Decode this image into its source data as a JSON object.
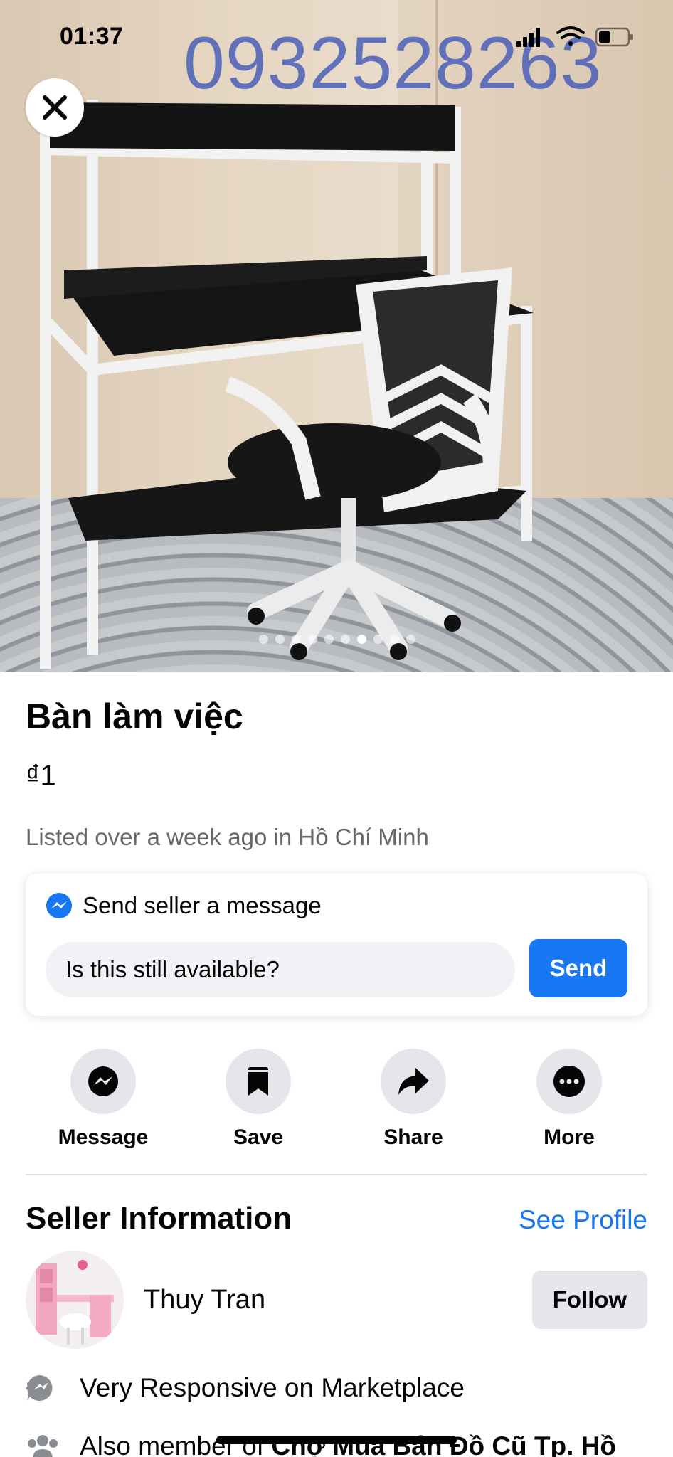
{
  "status_bar": {
    "time": "01:37"
  },
  "photo": {
    "watermark": "0932528263",
    "close_icon": "close-icon",
    "image_count": 10,
    "active_index": 6
  },
  "listing": {
    "title": "Bàn làm việc",
    "price": "₫1",
    "listed": "Listed over a week ago in Hồ Chí Minh"
  },
  "message_card": {
    "icon": "messenger-icon",
    "heading": "Send seller a message",
    "input_value": "Is this still available?",
    "send_label": "Send"
  },
  "actions": [
    {
      "label": "Message",
      "icon": "messenger-icon"
    },
    {
      "label": "Save",
      "icon": "bookmark-icon"
    },
    {
      "label": "Share",
      "icon": "share-arrow-icon"
    },
    {
      "label": "More",
      "icon": "more-dots-icon"
    }
  ],
  "seller": {
    "section_title": "Seller Information",
    "see_profile": "See Profile",
    "name": "Thuy Tran",
    "follow_label": "Follow",
    "facts": [
      {
        "icon": "responsive-badge-icon",
        "text": "Very Responsive on Marketplace"
      },
      {
        "icon": "group-icon",
        "prefix": "Also member of ",
        "bold": "Chợ Mua Bán Đồ Cũ Tp. Hồ"
      }
    ]
  },
  "colors": {
    "accent": "#1877f2",
    "secondary_text": "#65676b",
    "button_gray": "#e4e6eb",
    "input_bg": "#f0f2f5",
    "watermark": "#4a5fb8"
  }
}
